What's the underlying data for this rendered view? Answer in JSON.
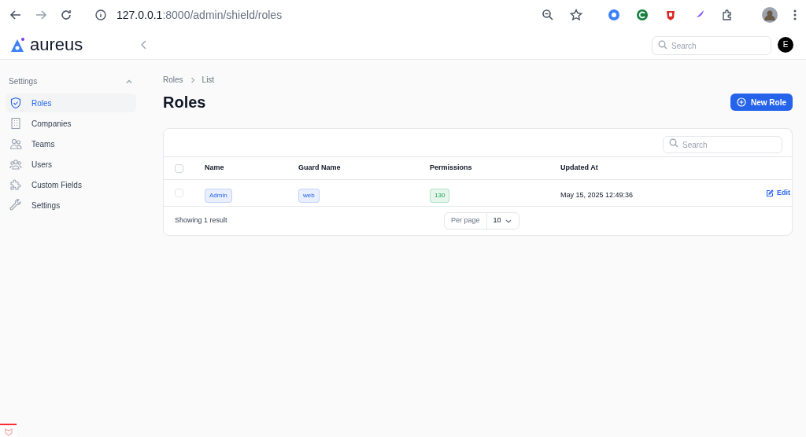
{
  "browser": {
    "url_host": "127.0.0.1",
    "url_path": ":8000/admin/shield/roles"
  },
  "header": {
    "logo": "aureus",
    "search": {
      "placeholder": "Search"
    },
    "avatar": "E"
  },
  "sidebar": {
    "group": "Settings",
    "expanded": true,
    "items": [
      {
        "label": "Roles",
        "selected": true
      },
      {
        "label": "Companies",
        "selected": false
      },
      {
        "label": "Teams",
        "selected": false
      },
      {
        "label": "Users",
        "selected": false
      },
      {
        "label": "Custom Fields",
        "selected": false
      },
      {
        "label": "Settings",
        "selected": false
      }
    ]
  },
  "breadcrumbs": [
    "Roles",
    "List"
  ],
  "page_title": "Roles",
  "new_button": "New Role",
  "table": {
    "search": {
      "placeholder": "Search"
    },
    "all_checked": false,
    "columns": [
      "Name",
      "Guard Name",
      "Permissions",
      "Updated At"
    ],
    "rows": [
      {
        "checked": false,
        "cells": [
          {
            "kind": "info",
            "text": "Admin"
          },
          {
            "kind": "info",
            "text": "web"
          },
          {
            "kind": "success",
            "text": "130"
          },
          {
            "kind": "text",
            "text": "May 15, 2025 12:49:36"
          }
        ],
        "action": "Edit"
      }
    ],
    "footer": {
      "summary": "Showing 1 result",
      "per_page_label": "Per page",
      "per_page_value": "10"
    }
  }
}
